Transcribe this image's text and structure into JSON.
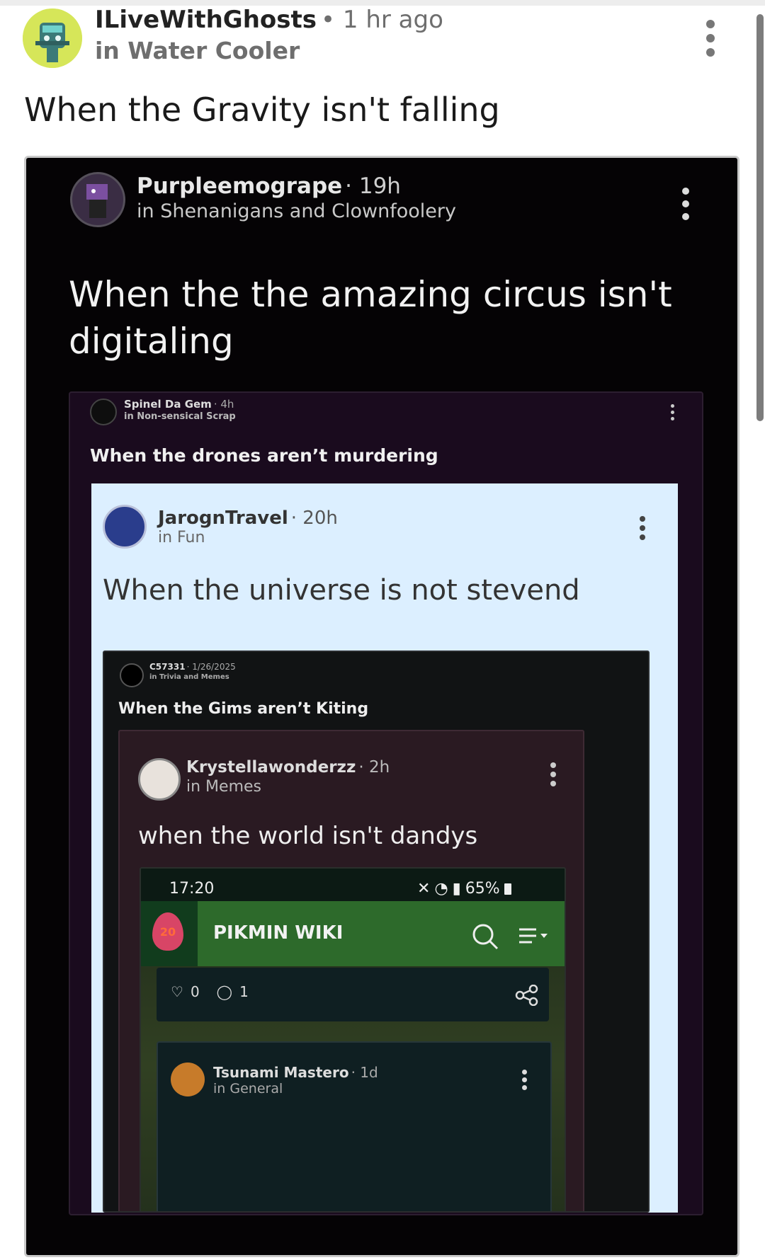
{
  "post": {
    "username": "ILiveWithGhosts",
    "time": "• 1 hr ago",
    "community": "in Water Cooler",
    "title": "When the Gravity isn't falling"
  },
  "level1": {
    "username": "Purpleemogrape",
    "time": "· 19h",
    "community": "in Shenanigans and Clownfoolery",
    "title": "When the the amazing circus isn't digitaling"
  },
  "level2": {
    "username": "Spinel Da Gem",
    "time": "· 4h",
    "community": "in Non-sensical Scrap",
    "title": "When the drones aren’t murdering"
  },
  "level3": {
    "username": "JarognTravel",
    "time": "· 20h",
    "community": "in Fun",
    "title": "When the universe is not stevend"
  },
  "level4": {
    "username": "C57331",
    "time": "· 1/26/2025",
    "community": "in Trivia and Memes",
    "title": "When the Gims aren’t Kiting"
  },
  "level5": {
    "username": "Krystellawonderzz",
    "time": "· 2h",
    "community": "in Memes",
    "title": "when the world isn't dandys"
  },
  "phone": {
    "clock": "17:20",
    "battery": "65%",
    "badge": "20",
    "app_title": "PIKMIN WIKI",
    "likes": "0",
    "comments": "1",
    "comment_user": "Tsunami Mastero",
    "comment_time": "· 1d",
    "comment_community": "in General"
  },
  "colors": {
    "wiki_green": "#2d6a2b",
    "flame": "#d84566",
    "card_blue": "#dcefff"
  }
}
